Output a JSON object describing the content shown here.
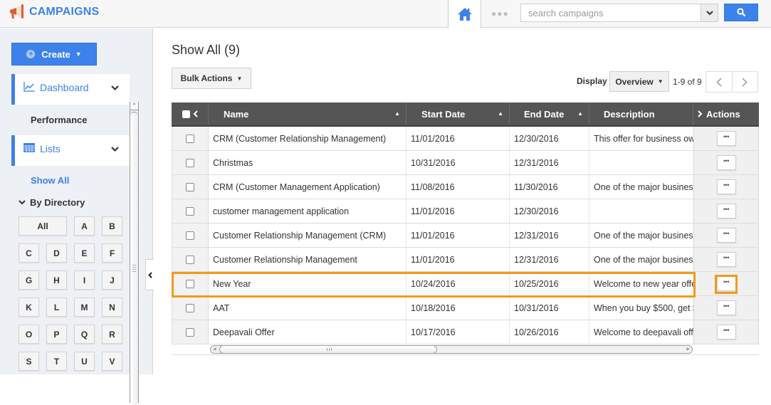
{
  "app": {
    "title": "CAMPAIGNS",
    "icon": "megaphone-icon"
  },
  "topbar": {
    "home_icon": "home-icon",
    "more_icon": "more-dots-icon",
    "more_text": "●●●",
    "search": {
      "placeholder": "search campaigns",
      "value": ""
    },
    "search_button_icon": "search-icon"
  },
  "sidebar": {
    "create_label": "Create",
    "nav": [
      {
        "label": "Dashboard",
        "icon": "chart-line-icon",
        "sub": [
          "Performance"
        ]
      },
      {
        "label": "Lists",
        "icon": "table-grid-icon",
        "sub": [
          "Show All"
        ]
      }
    ],
    "by_directory_label": "By Directory",
    "directory_letters": [
      "All",
      "A",
      "B",
      "C",
      "D",
      "E",
      "F",
      "G",
      "H",
      "I",
      "J",
      "K",
      "L",
      "M",
      "N",
      "O",
      "P",
      "Q",
      "R",
      "S",
      "T",
      "U",
      "V"
    ],
    "accent_color": "#3d82ea"
  },
  "main": {
    "title": "Show All (9)",
    "bulk_actions_label": "Bulk Actions",
    "display_label": "Display",
    "display_value": "Overview",
    "page_info": "1-9 of 9",
    "table": {
      "columns": [
        "Name",
        "Start Date",
        "End Date",
        "Description",
        "Actions"
      ],
      "rows": [
        {
          "name": "CRM (Customer Relationship Management)",
          "start": "11/01/2016",
          "end": "12/30/2016",
          "description": "This offer for business ow",
          "highlighted": false
        },
        {
          "name": "Christmas",
          "start": "10/31/2016",
          "end": "12/31/2016",
          "description": "",
          "highlighted": false
        },
        {
          "name": "CRM (Customer Management Application)",
          "start": "11/08/2016",
          "end": "11/30/2016",
          "description": "One of the major busines",
          "highlighted": false
        },
        {
          "name": "customer management application",
          "start": "11/01/2016",
          "end": "12/30/2016",
          "description": "",
          "highlighted": false
        },
        {
          "name": "Customer Relationship Management (CRM)",
          "start": "11/01/2016",
          "end": "12/31/2016",
          "description": "One of the major busines",
          "highlighted": false
        },
        {
          "name": "Customer Relationship Management",
          "start": "11/01/2016",
          "end": "12/31/2016",
          "description": "One of the major busines",
          "highlighted": false
        },
        {
          "name": "New Year",
          "start": "10/24/2016",
          "end": "10/25/2016",
          "description": "Welcome to new year offe",
          "highlighted": true
        },
        {
          "name": "AAT",
          "start": "10/18/2016",
          "end": "10/31/2016",
          "description": "When you buy $500, get $",
          "highlighted": false
        },
        {
          "name": "Deepavali Offer",
          "start": "10/17/2016",
          "end": "10/26/2016",
          "description": "Welcome to deepavali off",
          "highlighted": false
        }
      ],
      "row_action_label": "•••"
    },
    "highlight_color": "#f39a1a"
  }
}
